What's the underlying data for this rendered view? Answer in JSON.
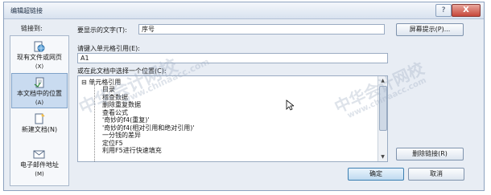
{
  "dialog": {
    "title": "编辑超链接",
    "help_label": "?",
    "close_label": "X"
  },
  "sidebar": {
    "label": "链接到:",
    "items": [
      {
        "label": "现有文件或网页",
        "key": "(X)",
        "icon": "globe-doc-icon",
        "active": false
      },
      {
        "label": "本文档中的位置",
        "key": "(A)",
        "icon": "doc-place-icon",
        "active": true
      },
      {
        "label": "新建文档(N)",
        "key": "",
        "icon": "new-doc-icon",
        "active": false
      },
      {
        "label": "电子邮件地址",
        "key": "(M)",
        "icon": "email-icon",
        "active": false
      }
    ]
  },
  "display_text": {
    "label": "要显示的文字(T):",
    "value": "序号"
  },
  "screentip_button": "屏幕提示(P)...",
  "cell_ref": {
    "label": "请键入单元格引用(E):",
    "value": "A1"
  },
  "place_in_doc": {
    "label": "或在此文档中选择一个位置(C):",
    "root": "单元格引用",
    "root_toggle": "⊟",
    "items": [
      "目录",
      "稽查数据",
      "删除重复数据",
      "查看公式",
      "'奇妙的f4(重复)'",
      "'奇妙的f4(相对引用和绝对引用)'",
      "一分钱的差异",
      "定位F5",
      "利用F5进行快速填充"
    ]
  },
  "remove_link_button": "删除链接(R)",
  "ok_button": "确定",
  "cancel_button": "取消",
  "watermarks": {
    "brand": "中华会计网校",
    "url": "www.chinaacc.com"
  }
}
